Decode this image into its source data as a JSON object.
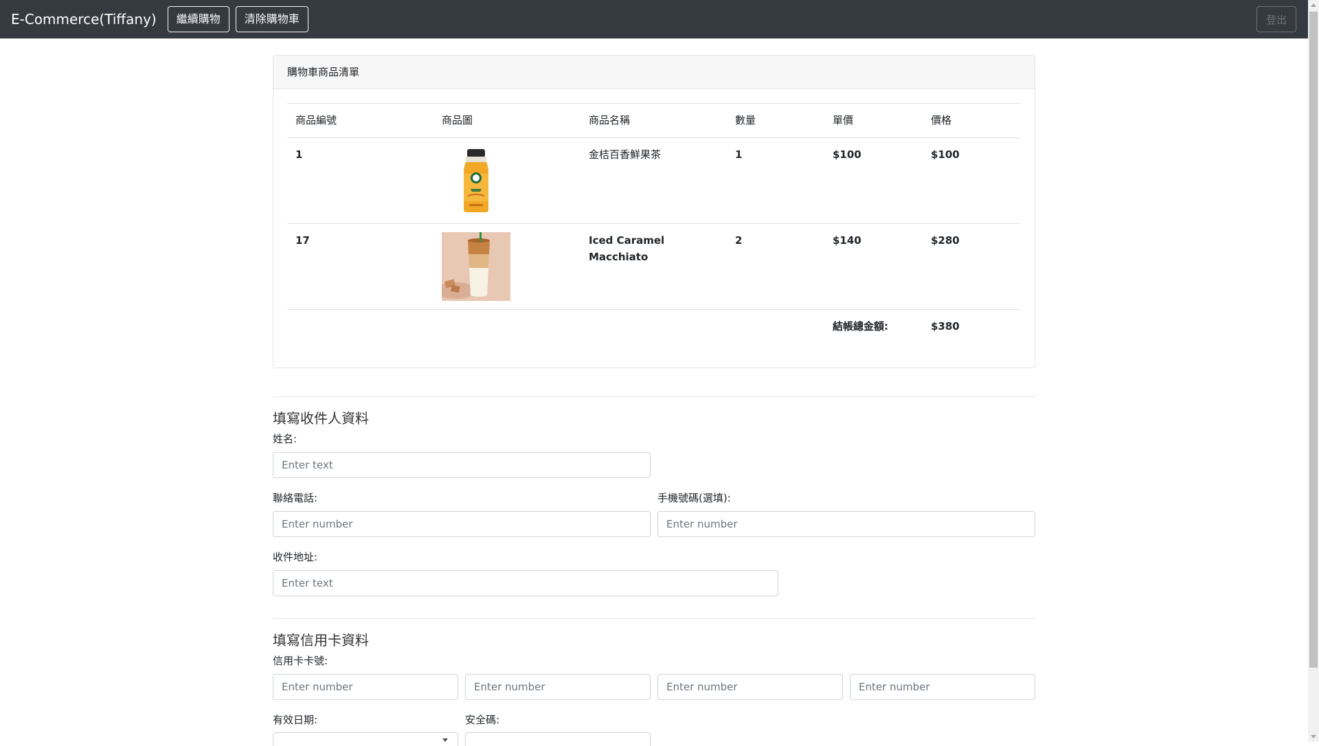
{
  "navbar": {
    "brand": "E-Commerce(Tiffany)",
    "continue_label": "繼續購物",
    "clear_label": "清除購物車",
    "logout_label": "登出"
  },
  "cart": {
    "header": "購物車商品清單",
    "columns": [
      "商品編號",
      "商品圖",
      "商品名稱",
      "數量",
      "單價",
      "價格"
    ],
    "items": [
      {
        "id": "1",
        "image": "orange-tea-bottle-image",
        "name": "金桔百香鮮果茶",
        "qty": "1",
        "unit_price": "$100",
        "price": "$100"
      },
      {
        "id": "17",
        "image": "iced-caramel-macchiato-image",
        "name": "Iced Caramel Macchiato",
        "qty": "2",
        "unit_price": "$140",
        "price": "$280"
      }
    ],
    "total_label": "結帳總金額:",
    "total_value": "$380"
  },
  "recipient": {
    "title": "填寫收件人資料",
    "name_label": "姓名:",
    "name_placeholder": "Enter text",
    "phone_label": "聯絡電話:",
    "phone_placeholder": "Enter number",
    "mobile_label": "手機號碼(選填):",
    "mobile_placeholder": "Enter number",
    "address_label": "收件地址:",
    "address_placeholder": "Enter text"
  },
  "card_info": {
    "title": "填寫信用卡資料",
    "number_label": "信用卡卡號:",
    "number_placeholders": [
      "Enter number",
      "Enter number",
      "Enter number",
      "Enter number"
    ],
    "expiry_label": "有效日期:",
    "cvv_label": "安全碼:"
  }
}
